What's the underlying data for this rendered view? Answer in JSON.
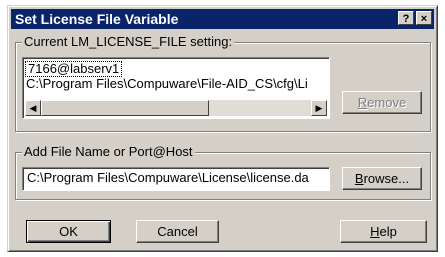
{
  "window": {
    "title": "Set License File Variable",
    "help_button": "?",
    "close_button": "×"
  },
  "current_group": {
    "legend": "Current LM_LICENSE_FILE setting:",
    "items": [
      "7166@labserv1",
      "C:\\Program Files\\Compuware\\File-AID_CS\\cfg\\Li"
    ],
    "remove_label_pre": "",
    "remove_label_key": "R",
    "remove_label_post": "emove"
  },
  "add_group": {
    "legend": "Add File Name or Port@Host",
    "value": "C:\\Program Files\\Compuware\\License\\license.da",
    "browse_label_key": "B",
    "browse_label_post": "rowse..."
  },
  "footer": {
    "ok_label": "OK",
    "cancel_label": "Cancel",
    "help_label_key": "H",
    "help_label_post": "elp"
  }
}
